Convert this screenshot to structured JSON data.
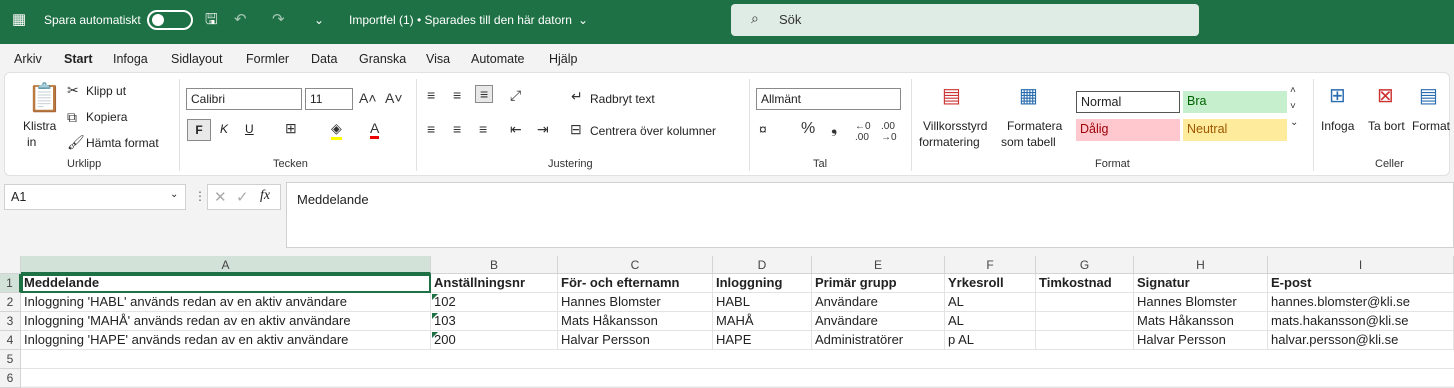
{
  "titlebar": {
    "autosave_label": "Spara automatiskt",
    "doc_title": "Importfel (1) • Sparades till den här datorn",
    "search_placeholder": "Sök"
  },
  "tabs": [
    "Arkiv",
    "Start",
    "Infoga",
    "Sidlayout",
    "Formler",
    "Data",
    "Granska",
    "Visa",
    "Automate",
    "Hjälp"
  ],
  "ribbon": {
    "clipboard": {
      "paste": "Klistra",
      "paste2": "in",
      "cut": "Klipp ut",
      "copy": "Kopiera",
      "format_painter": "Hämta format",
      "group": "Urklipp"
    },
    "font": {
      "name": "Calibri",
      "size": "11",
      "bold": "F",
      "italic": "K",
      "underline": "U",
      "group": "Tecken"
    },
    "alignment": {
      "wrap": "Radbryt text",
      "merge": "Centrera över kolumner",
      "group": "Justering"
    },
    "number": {
      "format": "Allmänt",
      "group": "Tal"
    },
    "styles": {
      "cond1": "Villkorsstyrd",
      "cond2": "formatering",
      "table1": "Formatera",
      "table2": "som tabell",
      "normal": "Normal",
      "good": "Bra",
      "bad": "Dålig",
      "neutral": "Neutral",
      "group": "Format"
    },
    "cells": {
      "insert": "Infoga",
      "delete": "Ta bort",
      "format": "Format",
      "group": "Celler"
    }
  },
  "formula": {
    "cellref": "A1",
    "fx": "fx",
    "content": "Meddelande"
  },
  "columns": [
    "A",
    "B",
    "C",
    "D",
    "E",
    "F",
    "G",
    "H",
    "I"
  ],
  "rows": [
    "1",
    "2",
    "3",
    "4",
    "5",
    "6"
  ],
  "headers": [
    "Meddelande",
    "Anställningsnr",
    "För- och efternamn",
    "Inloggning",
    "Primär grupp",
    "Yrkesroll",
    "Timkostnad",
    "Signatur",
    "E-post"
  ],
  "data": [
    [
      "Inloggning 'HABL' används redan av en aktiv användare",
      "102",
      "Hannes Blomster",
      "HABL",
      "Användare",
      "AL",
      "",
      "Hannes Blomster",
      "hannes.blomster@kli.se"
    ],
    [
      "Inloggning 'MAHÅ' används redan av en aktiv användare",
      "103",
      "Mats Håkansson",
      "MAHÅ",
      "Användare",
      "AL",
      "",
      "Mats Håkansson",
      "mats.hakansson@kli.se"
    ],
    [
      "Inloggning 'HAPE' används redan av en aktiv användare",
      "200",
      "Halvar Persson",
      "HAPE",
      "Administratörer",
      "p AL",
      "",
      "Halvar Persson",
      "halvar.persson@kli.se"
    ]
  ],
  "colors": {
    "accent": "#1e7145",
    "good_bg": "#c6efce",
    "bad_bg": "#ffc7ce",
    "neutral_bg": "#ffeb9c"
  }
}
